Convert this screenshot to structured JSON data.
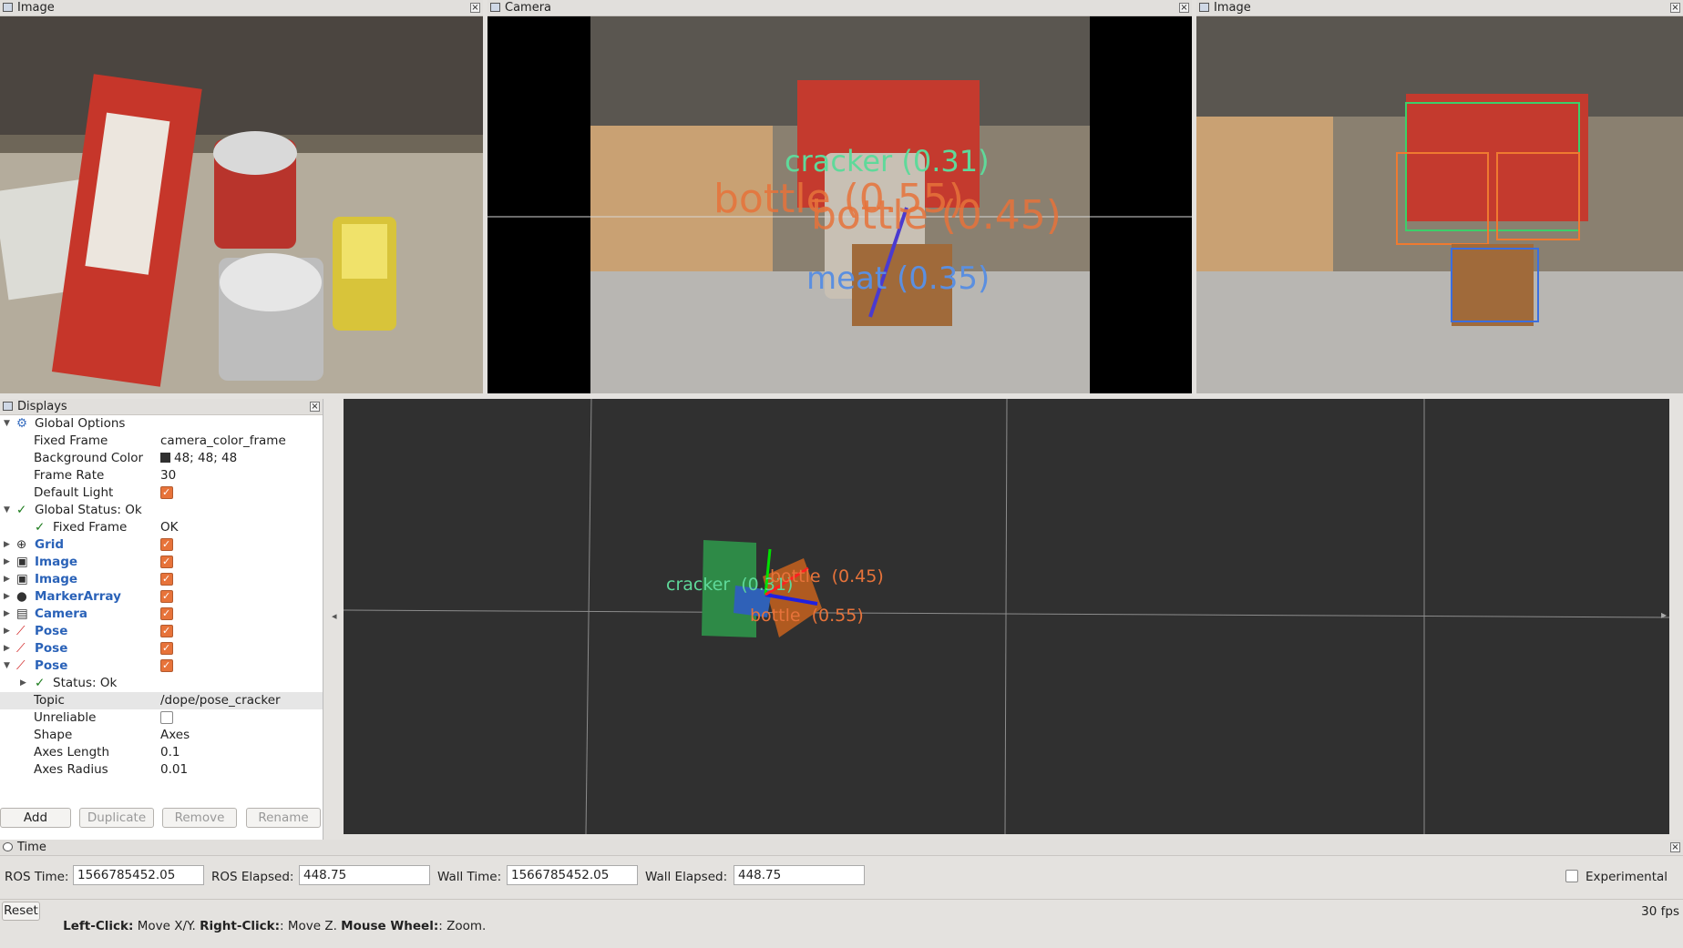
{
  "panels": {
    "image_left": {
      "title": "Image"
    },
    "camera": {
      "title": "Camera"
    },
    "image_right": {
      "title": "Image"
    }
  },
  "camera_labels": [
    {
      "text": "cracker  (0.31)",
      "color": "#5fd99a"
    },
    {
      "text": "bottle  (0.55)",
      "color": "#e7733a"
    },
    {
      "text": "bottle  (0.45)",
      "color": "#e7733a"
    },
    {
      "text": "meat  (0.35)",
      "color": "#5b8fe0"
    }
  ],
  "displays": {
    "title": "Displays",
    "global_options": "Global Options",
    "fixed_frame_label": "Fixed Frame",
    "fixed_frame_value": "camera_color_frame",
    "bg_color_label": "Background Color",
    "bg_color_value": "48; 48; 48",
    "frame_rate_label": "Frame Rate",
    "frame_rate_value": "30",
    "default_light_label": "Default Light",
    "global_status": "Global Status: Ok",
    "status_fixed_frame": "Fixed Frame",
    "status_fixed_frame_value": "OK",
    "items": [
      {
        "label": "Grid",
        "icon": "grid-icon"
      },
      {
        "label": "Image",
        "icon": "image-icon"
      },
      {
        "label": "Image",
        "icon": "image-icon"
      },
      {
        "label": "MarkerArray",
        "icon": "marker-array-icon"
      },
      {
        "label": "Camera",
        "icon": "camera-icon"
      },
      {
        "label": "Pose",
        "icon": "pose-icon"
      },
      {
        "label": "Pose",
        "icon": "pose-icon"
      },
      {
        "label": "Pose",
        "icon": "pose-icon"
      }
    ],
    "pose_status": "Status: Ok",
    "topic_label": "Topic",
    "topic_value": "/dope/pose_cracker",
    "unreliable_label": "Unreliable",
    "shape_label": "Shape",
    "shape_value": "Axes",
    "axes_length_label": "Axes Length",
    "axes_length_value": "0.1",
    "axes_radius_label": "Axes Radius",
    "axes_radius_value": "0.01",
    "buttons": {
      "add": "Add",
      "duplicate": "Duplicate",
      "remove": "Remove",
      "rename": "Rename"
    }
  },
  "view3d": {
    "labels": [
      {
        "text": "cracker  (0.31)",
        "color": "#5fd99a"
      },
      {
        "text": "bottle  (0.45)",
        "color": "#e7733a"
      },
      {
        "text": "bottle  (0.55)",
        "color": "#e7733a"
      }
    ]
  },
  "time": {
    "title": "Time",
    "ros_time_label": "ROS Time:",
    "ros_time_value": "1566785452.05",
    "ros_elapsed_label": "ROS Elapsed:",
    "ros_elapsed_value": "448.75",
    "wall_time_label": "Wall Time:",
    "wall_time_value": "1566785452.05",
    "wall_elapsed_label": "Wall Elapsed:",
    "wall_elapsed_value": "448.75",
    "experimental_label": "Experimental"
  },
  "status": {
    "reset": "Reset",
    "left_click": "Left-Click:",
    "left_click_desc": " Move X/Y. ",
    "right_click": "Right-Click:",
    "right_click_desc": ": Move Z. ",
    "wheel": "Mouse Wheel:",
    "wheel_desc": ": Zoom.",
    "fps": "30 fps"
  }
}
